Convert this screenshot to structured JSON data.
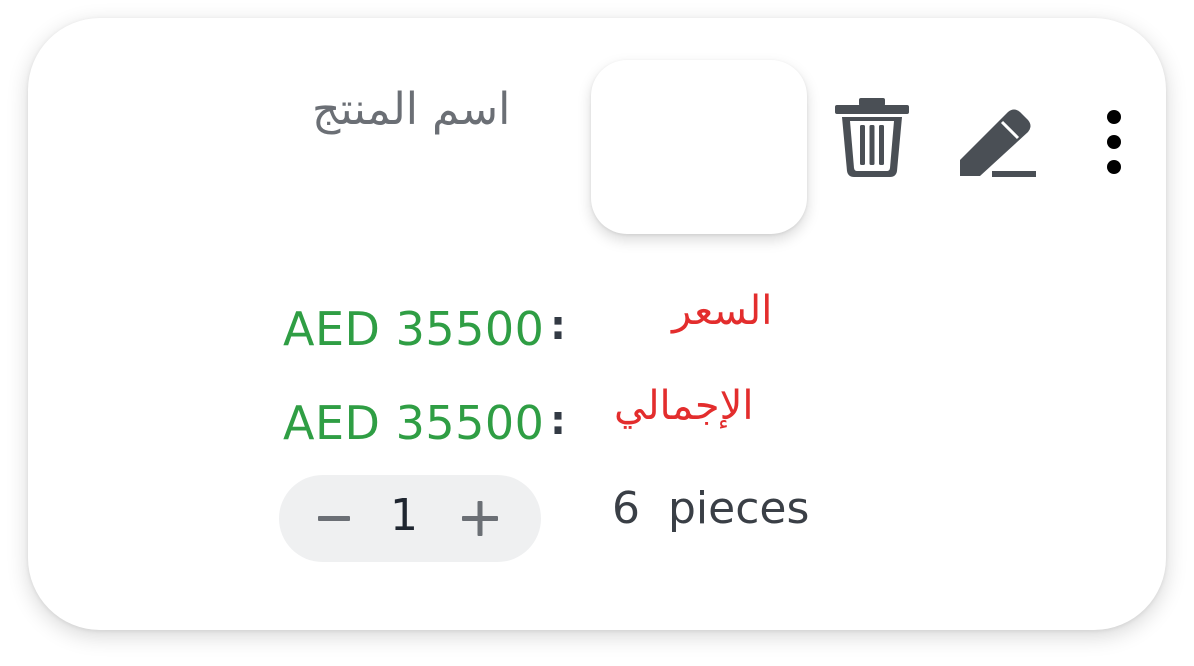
{
  "product": {
    "name": "اسم المنتج"
  },
  "actions": {
    "delete_icon": "trash-icon",
    "edit_icon": "pencil-icon",
    "more_icon": "more-vertical-icon"
  },
  "price": {
    "label": "السعر",
    "separator": ":",
    "value": "AED 35500"
  },
  "total": {
    "label": "الإجمالي",
    "separator": ":",
    "value": "AED 35500"
  },
  "quantity": {
    "minus_symbol": "−",
    "value": "1",
    "plus_symbol": "+"
  },
  "stock": {
    "count": "6",
    "unit": "pieces"
  },
  "colors": {
    "price_green": "#2f9e44",
    "label_red": "#e32d2d",
    "icon_dark": "#4a4f55"
  }
}
